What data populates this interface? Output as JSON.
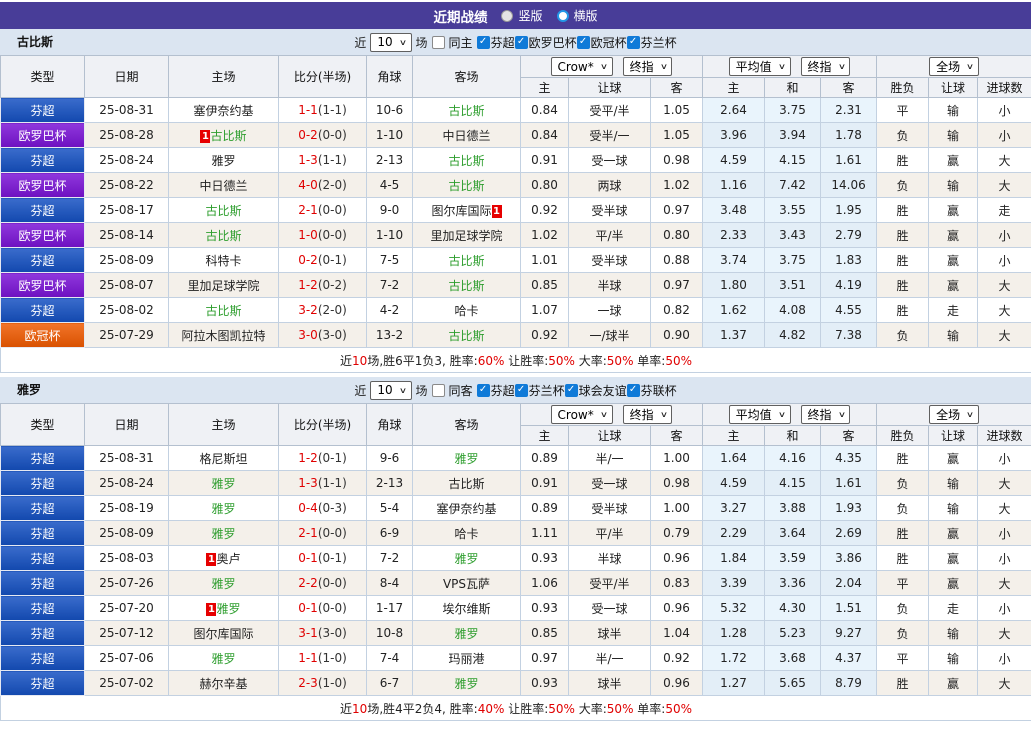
{
  "header": {
    "title": "近期战绩",
    "radio_vertical": "竖版",
    "radio_horizontal": "横版",
    "selected_layout": "横版"
  },
  "filter": {
    "near_label": "近",
    "matches_value": "10",
    "matches_label": "场"
  },
  "dropdowns": {
    "odds_source": "Crow*",
    "odds_time": "终指",
    "avg_source": "平均值",
    "avg_time": "终指",
    "scope": "全场"
  },
  "columns": {
    "type": "类型",
    "date": "日期",
    "home": "主场",
    "score": "比分(半场)",
    "corner": "角球",
    "away": "客场",
    "odds_home": "主",
    "odds_handicap": "让球",
    "odds_away": "客",
    "avg_home": "主",
    "avg_draw": "和",
    "avg_away": "客",
    "result_wdl": "胜负",
    "result_handicap": "让球",
    "result_goals": "进球数"
  },
  "league_colors": {
    "芬超": "#1450c2",
    "欧罗巴杯": "#7a12d6",
    "欧冠杯": "#f05a00"
  },
  "colors": {
    "topbar": "#483d98",
    "filter_bg": "#dbe5f1",
    "self_team_green": "#2e9e2e",
    "score_red": "#e00000",
    "win_red": "#dd2020",
    "lose_blue": "#2433cc",
    "draw_green": "#0e8b0e"
  },
  "sections": [
    {
      "team": "古比斯",
      "same_label": "同主",
      "leagues": [
        "芬超",
        "欧罗巴杯",
        "欧冠杯",
        "芬兰杯"
      ],
      "rows": [
        {
          "league": "芬超",
          "date": "25-08-31",
          "home": "塞伊奈约基",
          "home_self": false,
          "home_badge": false,
          "ft": "1-1",
          "ht": "(1-1)",
          "corner": "10-6",
          "away": "古比斯",
          "away_self": true,
          "away_badge": false,
          "odds": [
            "0.84",
            "受平/半",
            "1.05"
          ],
          "avg": [
            "2.64",
            "3.75",
            "2.31"
          ],
          "results": [
            {
              "t": "平",
              "c": "green"
            },
            {
              "t": "输",
              "c": "blue"
            },
            {
              "t": "小",
              "c": "blue"
            }
          ]
        },
        {
          "league": "欧罗巴杯",
          "date": "25-08-28",
          "home": "古比斯",
          "home_self": true,
          "home_badge": true,
          "ft": "0-2",
          "ht": "(0-0)",
          "corner": "1-10",
          "away": "中日德兰",
          "away_self": false,
          "away_badge": false,
          "odds": [
            "0.84",
            "受半/一",
            "1.05"
          ],
          "avg": [
            "3.96",
            "3.94",
            "1.78"
          ],
          "results": [
            {
              "t": "负",
              "c": "blue"
            },
            {
              "t": "输",
              "c": "blue"
            },
            {
              "t": "小",
              "c": "blue"
            }
          ]
        },
        {
          "league": "芬超",
          "date": "25-08-24",
          "home": "雅罗",
          "home_self": false,
          "home_badge": false,
          "ft": "1-3",
          "ht": "(1-1)",
          "corner": "2-13",
          "away": "古比斯",
          "away_self": true,
          "away_badge": false,
          "odds": [
            "0.91",
            "受一球",
            "0.98"
          ],
          "avg": [
            "4.59",
            "4.15",
            "1.61"
          ],
          "results": [
            {
              "t": "胜",
              "c": "red"
            },
            {
              "t": "赢",
              "c": "red"
            },
            {
              "t": "大",
              "c": "red"
            }
          ]
        },
        {
          "league": "欧罗巴杯",
          "date": "25-08-22",
          "home": "中日德兰",
          "home_self": false,
          "home_badge": false,
          "ft": "4-0",
          "ht": "(2-0)",
          "corner": "4-5",
          "away": "古比斯",
          "away_self": true,
          "away_badge": false,
          "odds": [
            "0.80",
            "两球",
            "1.02"
          ],
          "avg": [
            "1.16",
            "7.42",
            "14.06"
          ],
          "results": [
            {
              "t": "负",
              "c": "blue"
            },
            {
              "t": "输",
              "c": "blue"
            },
            {
              "t": "大",
              "c": "red"
            }
          ]
        },
        {
          "league": "芬超",
          "date": "25-08-17",
          "home": "古比斯",
          "home_self": true,
          "home_badge": false,
          "ft": "2-1",
          "ht": "(0-0)",
          "corner": "9-0",
          "away": "图尔库国际",
          "away_self": false,
          "away_badge": true,
          "odds": [
            "0.92",
            "受半球",
            "0.97"
          ],
          "avg": [
            "3.48",
            "3.55",
            "1.95"
          ],
          "results": [
            {
              "t": "胜",
              "c": "red"
            },
            {
              "t": "赢",
              "c": "red"
            },
            {
              "t": "走",
              "c": "green"
            }
          ]
        },
        {
          "league": "欧罗巴杯",
          "date": "25-08-14",
          "home": "古比斯",
          "home_self": true,
          "home_badge": false,
          "ft": "1-0",
          "ht": "(0-0)",
          "corner": "1-10",
          "away": "里加足球学院",
          "away_self": false,
          "away_badge": false,
          "odds": [
            "1.02",
            "平/半",
            "0.80"
          ],
          "avg": [
            "2.33",
            "3.43",
            "2.79"
          ],
          "results": [
            {
              "t": "胜",
              "c": "red"
            },
            {
              "t": "赢",
              "c": "red"
            },
            {
              "t": "小",
              "c": "blue"
            }
          ]
        },
        {
          "league": "芬超",
          "date": "25-08-09",
          "home": "科特卡",
          "home_self": false,
          "home_badge": false,
          "ft": "0-2",
          "ht": "(0-1)",
          "corner": "7-5",
          "away": "古比斯",
          "away_self": true,
          "away_badge": false,
          "odds": [
            "1.01",
            "受半球",
            "0.88"
          ],
          "avg": [
            "3.74",
            "3.75",
            "1.83"
          ],
          "results": [
            {
              "t": "胜",
              "c": "red"
            },
            {
              "t": "赢",
              "c": "red"
            },
            {
              "t": "小",
              "c": "blue"
            }
          ]
        },
        {
          "league": "欧罗巴杯",
          "date": "25-08-07",
          "home": "里加足球学院",
          "home_self": false,
          "home_badge": false,
          "ft": "1-2",
          "ht": "(0-2)",
          "corner": "7-2",
          "away": "古比斯",
          "away_self": true,
          "away_badge": false,
          "odds": [
            "0.85",
            "半球",
            "0.97"
          ],
          "avg": [
            "1.80",
            "3.51",
            "4.19"
          ],
          "results": [
            {
              "t": "胜",
              "c": "red"
            },
            {
              "t": "赢",
              "c": "red"
            },
            {
              "t": "大",
              "c": "red"
            }
          ]
        },
        {
          "league": "芬超",
          "date": "25-08-02",
          "home": "古比斯",
          "home_self": true,
          "home_badge": false,
          "ft": "3-2",
          "ht": "(2-0)",
          "corner": "4-2",
          "away": "哈卡",
          "away_self": false,
          "away_badge": false,
          "odds": [
            "1.07",
            "一球",
            "0.82"
          ],
          "avg": [
            "1.62",
            "4.08",
            "4.55"
          ],
          "results": [
            {
              "t": "胜",
              "c": "red"
            },
            {
              "t": "走",
              "c": "green"
            },
            {
              "t": "大",
              "c": "red"
            }
          ]
        },
        {
          "league": "欧冠杯",
          "date": "25-07-29",
          "home": "阿拉木图凯拉特",
          "home_self": false,
          "home_badge": false,
          "ft": "3-0",
          "ht": "(3-0)",
          "corner": "13-2",
          "away": "古比斯",
          "away_self": true,
          "away_badge": false,
          "odds": [
            "0.92",
            "一/球半",
            "0.90"
          ],
          "avg": [
            "1.37",
            "4.82",
            "7.38"
          ],
          "results": [
            {
              "t": "负",
              "c": "blue"
            },
            {
              "t": "输",
              "c": "blue"
            },
            {
              "t": "大",
              "c": "red"
            }
          ]
        }
      ],
      "summary": [
        {
          "t": "近",
          "red": false
        },
        {
          "t": "10",
          "red": true
        },
        {
          "t": "场,胜6平1负3, 胜率:",
          "red": false
        },
        {
          "t": "60%",
          "red": true
        },
        {
          "t": " 让胜率:",
          "red": false
        },
        {
          "t": "50%",
          "red": true
        },
        {
          "t": " 大率:",
          "red": false
        },
        {
          "t": "50%",
          "red": true
        },
        {
          "t": " 单率:",
          "red": false
        },
        {
          "t": "50%",
          "red": true
        }
      ]
    },
    {
      "team": "雅罗",
      "same_label": "同客",
      "leagues": [
        "芬超",
        "芬兰杯",
        "球会友谊",
        "芬联杯"
      ],
      "rows": [
        {
          "league": "芬超",
          "date": "25-08-31",
          "home": "格尼斯坦",
          "home_self": false,
          "home_badge": false,
          "ft": "1-2",
          "ht": "(0-1)",
          "corner": "9-6",
          "away": "雅罗",
          "away_self": true,
          "away_badge": false,
          "odds": [
            "0.89",
            "半/一",
            "1.00"
          ],
          "avg": [
            "1.64",
            "4.16",
            "4.35"
          ],
          "results": [
            {
              "t": "胜",
              "c": "red"
            },
            {
              "t": "赢",
              "c": "red"
            },
            {
              "t": "小",
              "c": "blue"
            }
          ]
        },
        {
          "league": "芬超",
          "date": "25-08-24",
          "home": "雅罗",
          "home_self": true,
          "home_badge": false,
          "ft": "1-3",
          "ht": "(1-1)",
          "corner": "2-13",
          "away": "古比斯",
          "away_self": false,
          "away_badge": false,
          "odds": [
            "0.91",
            "受一球",
            "0.98"
          ],
          "avg": [
            "4.59",
            "4.15",
            "1.61"
          ],
          "results": [
            {
              "t": "负",
              "c": "blue"
            },
            {
              "t": "输",
              "c": "blue"
            },
            {
              "t": "大",
              "c": "red"
            }
          ]
        },
        {
          "league": "芬超",
          "date": "25-08-19",
          "home": "雅罗",
          "home_self": true,
          "home_badge": false,
          "ft": "0-4",
          "ht": "(0-3)",
          "corner": "5-4",
          "away": "塞伊奈约基",
          "away_self": false,
          "away_badge": false,
          "odds": [
            "0.89",
            "受半球",
            "1.00"
          ],
          "avg": [
            "3.27",
            "3.88",
            "1.93"
          ],
          "results": [
            {
              "t": "负",
              "c": "blue"
            },
            {
              "t": "输",
              "c": "blue"
            },
            {
              "t": "大",
              "c": "red"
            }
          ]
        },
        {
          "league": "芬超",
          "date": "25-08-09",
          "home": "雅罗",
          "home_self": true,
          "home_badge": false,
          "ft": "2-1",
          "ht": "(0-0)",
          "corner": "6-9",
          "away": "哈卡",
          "away_self": false,
          "away_badge": false,
          "odds": [
            "1.11",
            "平/半",
            "0.79"
          ],
          "avg": [
            "2.29",
            "3.64",
            "2.69"
          ],
          "results": [
            {
              "t": "胜",
              "c": "red"
            },
            {
              "t": "赢",
              "c": "red"
            },
            {
              "t": "小",
              "c": "blue"
            }
          ]
        },
        {
          "league": "芬超",
          "date": "25-08-03",
          "home": "奥卢",
          "home_self": false,
          "home_badge": true,
          "ft": "0-1",
          "ht": "(0-1)",
          "corner": "7-2",
          "away": "雅罗",
          "away_self": true,
          "away_badge": false,
          "odds": [
            "0.93",
            "半球",
            "0.96"
          ],
          "avg": [
            "1.84",
            "3.59",
            "3.86"
          ],
          "results": [
            {
              "t": "胜",
              "c": "red"
            },
            {
              "t": "赢",
              "c": "red"
            },
            {
              "t": "小",
              "c": "blue"
            }
          ]
        },
        {
          "league": "芬超",
          "date": "25-07-26",
          "home": "雅罗",
          "home_self": true,
          "home_badge": false,
          "ft": "2-2",
          "ht": "(0-0)",
          "corner": "8-4",
          "away": "VPS瓦萨",
          "away_self": false,
          "away_badge": false,
          "odds": [
            "1.06",
            "受平/半",
            "0.83"
          ],
          "avg": [
            "3.39",
            "3.36",
            "2.04"
          ],
          "results": [
            {
              "t": "平",
              "c": "green"
            },
            {
              "t": "赢",
              "c": "red"
            },
            {
              "t": "大",
              "c": "red"
            }
          ]
        },
        {
          "league": "芬超",
          "date": "25-07-20",
          "home": "雅罗",
          "home_self": true,
          "home_badge": true,
          "ft": "0-1",
          "ht": "(0-0)",
          "corner": "1-17",
          "away": "埃尔维斯",
          "away_self": false,
          "away_badge": false,
          "odds": [
            "0.93",
            "受一球",
            "0.96"
          ],
          "avg": [
            "5.32",
            "4.30",
            "1.51"
          ],
          "results": [
            {
              "t": "负",
              "c": "blue"
            },
            {
              "t": "走",
              "c": "green"
            },
            {
              "t": "小",
              "c": "blue"
            }
          ]
        },
        {
          "league": "芬超",
          "date": "25-07-12",
          "home": "图尔库国际",
          "home_self": false,
          "home_badge": false,
          "ft": "3-1",
          "ht": "(3-0)",
          "corner": "10-8",
          "away": "雅罗",
          "away_self": true,
          "away_badge": false,
          "odds": [
            "0.85",
            "球半",
            "1.04"
          ],
          "avg": [
            "1.28",
            "5.23",
            "9.27"
          ],
          "results": [
            {
              "t": "负",
              "c": "blue"
            },
            {
              "t": "输",
              "c": "blue"
            },
            {
              "t": "大",
              "c": "red"
            }
          ]
        },
        {
          "league": "芬超",
          "date": "25-07-06",
          "home": "雅罗",
          "home_self": true,
          "home_badge": false,
          "ft": "1-1",
          "ht": "(1-0)",
          "corner": "7-4",
          "away": "玛丽港",
          "away_self": false,
          "away_badge": false,
          "odds": [
            "0.97",
            "半/一",
            "0.92"
          ],
          "avg": [
            "1.72",
            "3.68",
            "4.37"
          ],
          "results": [
            {
              "t": "平",
              "c": "green"
            },
            {
              "t": "输",
              "c": "blue"
            },
            {
              "t": "小",
              "c": "blue"
            }
          ]
        },
        {
          "league": "芬超",
          "date": "25-07-02",
          "home": "赫尔辛基",
          "home_self": false,
          "home_badge": false,
          "ft": "2-3",
          "ht": "(1-0)",
          "corner": "6-7",
          "away": "雅罗",
          "away_self": true,
          "away_badge": false,
          "odds": [
            "0.93",
            "球半",
            "0.96"
          ],
          "avg": [
            "1.27",
            "5.65",
            "8.79"
          ],
          "results": [
            {
              "t": "胜",
              "c": "red"
            },
            {
              "t": "赢",
              "c": "red"
            },
            {
              "t": "大",
              "c": "red"
            }
          ]
        }
      ],
      "summary": [
        {
          "t": "近",
          "red": false
        },
        {
          "t": "10",
          "red": true
        },
        {
          "t": "场,胜4平2负4, 胜率:",
          "red": false
        },
        {
          "t": "40%",
          "red": true
        },
        {
          "t": " 让胜率:",
          "red": false
        },
        {
          "t": "50%",
          "red": true
        },
        {
          "t": " 大率:",
          "red": false
        },
        {
          "t": "50%",
          "red": true
        },
        {
          "t": " 单率:",
          "red": false
        },
        {
          "t": "50%",
          "red": true
        }
      ]
    }
  ]
}
